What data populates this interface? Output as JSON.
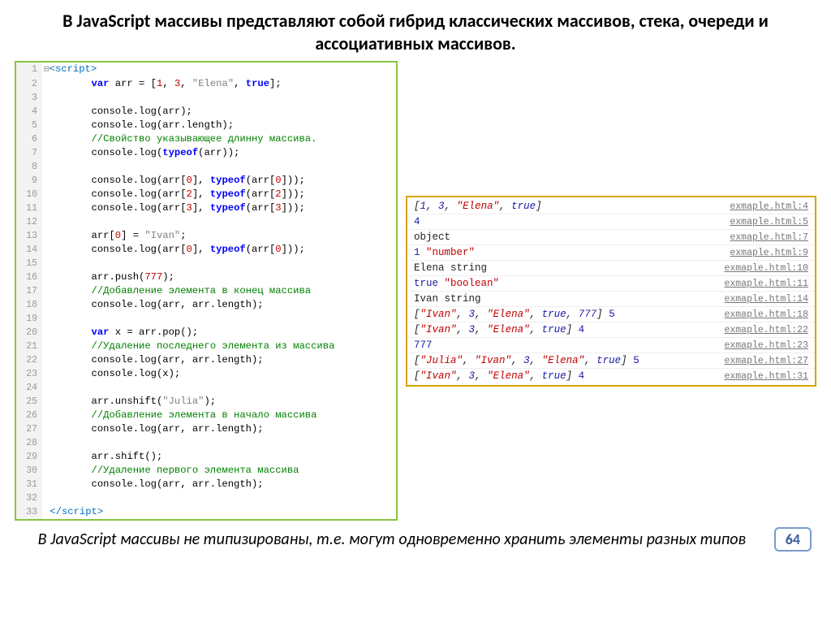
{
  "title": "В JavaScript массивы представляют собой гибрид классических массивов, стека, очереди и ассоциативных массивов.",
  "footer": "В JavaScript массивы не типизированы, т.е. могут одновременно хранить элементы разных типов",
  "slideNumber": "64",
  "code": [
    {
      "n": 1,
      "html": "<span class='boxchar'>⊟</span><span class='tag'>&lt;script&gt;</span>"
    },
    {
      "n": 2,
      "html": "        <span class='kw'>var</span> arr = [<span class='num'>1</span>, <span class='num'>3</span>, <span class='str'>\"Elena\"</span>, <span class='kw'>true</span>];"
    },
    {
      "n": 3,
      "html": ""
    },
    {
      "n": 4,
      "html": "        console.log(arr);"
    },
    {
      "n": 5,
      "html": "        console.log(arr.length);"
    },
    {
      "n": 6,
      "html": "        <span class='com'>//Свойство указывающее длинну массива.</span>"
    },
    {
      "n": 7,
      "html": "        console.log(<span class='kw'>typeof</span>(arr));"
    },
    {
      "n": 8,
      "html": ""
    },
    {
      "n": 9,
      "html": "        console.log(arr[<span class='num'>0</span>], <span class='kw'>typeof</span>(arr[<span class='num'>0</span>]));"
    },
    {
      "n": 10,
      "html": "        console.log(arr[<span class='num'>2</span>], <span class='kw'>typeof</span>(arr[<span class='num'>2</span>]));"
    },
    {
      "n": 11,
      "html": "        console.log(arr[<span class='num'>3</span>], <span class='kw'>typeof</span>(arr[<span class='num'>3</span>]));"
    },
    {
      "n": 12,
      "html": ""
    },
    {
      "n": 13,
      "html": "        arr[<span class='num'>0</span>] = <span class='str'>\"Ivan\"</span>;"
    },
    {
      "n": 14,
      "html": "        console.log(arr[<span class='num'>0</span>], <span class='kw'>typeof</span>(arr[<span class='num'>0</span>]));"
    },
    {
      "n": 15,
      "html": ""
    },
    {
      "n": 16,
      "html": "        arr.push(<span class='num'>777</span>);"
    },
    {
      "n": 17,
      "html": "        <span class='com'>//Добавление элемента в конец массива</span>"
    },
    {
      "n": 18,
      "html": "        console.log(arr, arr.length);"
    },
    {
      "n": 19,
      "html": ""
    },
    {
      "n": 20,
      "html": "        <span class='kw'>var</span> x = arr.pop();"
    },
    {
      "n": 21,
      "html": "        <span class='com'>//Удаление последнего элемента из массива</span>"
    },
    {
      "n": 22,
      "html": "        console.log(arr, arr.length);"
    },
    {
      "n": 23,
      "html": "        console.log(x);"
    },
    {
      "n": 24,
      "html": ""
    },
    {
      "n": 25,
      "html": "        arr.unshift(<span class='str'>\"Julia\"</span>);"
    },
    {
      "n": 26,
      "html": "        <span class='com'>//Добавление элемента в начало массива</span>"
    },
    {
      "n": 27,
      "html": "        console.log(arr, arr.length);"
    },
    {
      "n": 28,
      "html": ""
    },
    {
      "n": 29,
      "html": "        arr.shift();"
    },
    {
      "n": 30,
      "html": "        <span class='com'>//Удаление первого элемента массива</span>"
    },
    {
      "n": 31,
      "html": "        console.log(arr, arr.length);"
    },
    {
      "n": 32,
      "html": ""
    },
    {
      "n": 33,
      "html": " <span class='tag'>&lt;/script&gt;</span>"
    }
  ],
  "console": [
    {
      "val": "<span class='carr'>[<span class='cnum'>1</span>, <span class='cnum'>3</span>, <span class='cstr'>\"Elena\"</span>, <span class='cbool'>true</span>]</span>",
      "link": "exmaple.html:4"
    },
    {
      "val": "<span class='cnum'>4</span>",
      "link": "exmaple.html:5"
    },
    {
      "val": "object",
      "link": "exmaple.html:7"
    },
    {
      "val": "<span class='cnum'>1</span> <span class='cstr'>\"number\"</span>",
      "link": "exmaple.html:9"
    },
    {
      "val": "Elena string",
      "link": "exmaple.html:10"
    },
    {
      "val": "<span class='cbool'>true</span> <span class='cstr'>\"boolean\"</span>",
      "link": "exmaple.html:11"
    },
    {
      "val": "Ivan string",
      "link": "exmaple.html:14"
    },
    {
      "val": "<span class='carr'>[<span class='cstr'>\"Ivan\"</span>, <span class='cnum'>3</span>, <span class='cstr'>\"Elena\"</span>, <span class='cbool'>true</span>, <span class='cnum'>777</span>]</span> <span class='cnum'>5</span>",
      "link": "exmaple.html:18"
    },
    {
      "val": "<span class='carr'>[<span class='cstr'>\"Ivan\"</span>, <span class='cnum'>3</span>, <span class='cstr'>\"Elena\"</span>, <span class='cbool'>true</span>]</span> <span class='cnum'>4</span>",
      "link": "exmaple.html:22"
    },
    {
      "val": "<span class='cnum'>777</span>",
      "link": "exmaple.html:23"
    },
    {
      "val": "<span class='carr'>[<span class='cstr'>\"Julia\"</span>, <span class='cstr'>\"Ivan\"</span>, <span class='cnum'>3</span>, <span class='cstr'>\"Elena\"</span>, <span class='cbool'>true</span>]</span> <span class='cnum'>5</span>",
      "link": "exmaple.html:27"
    },
    {
      "val": "<span class='carr'>[<span class='cstr'>\"Ivan\"</span>, <span class='cnum'>3</span>, <span class='cstr'>\"Elena\"</span>, <span class='cbool'>true</span>]</span> <span class='cnum'>4</span>",
      "link": "exmaple.html:31"
    }
  ]
}
